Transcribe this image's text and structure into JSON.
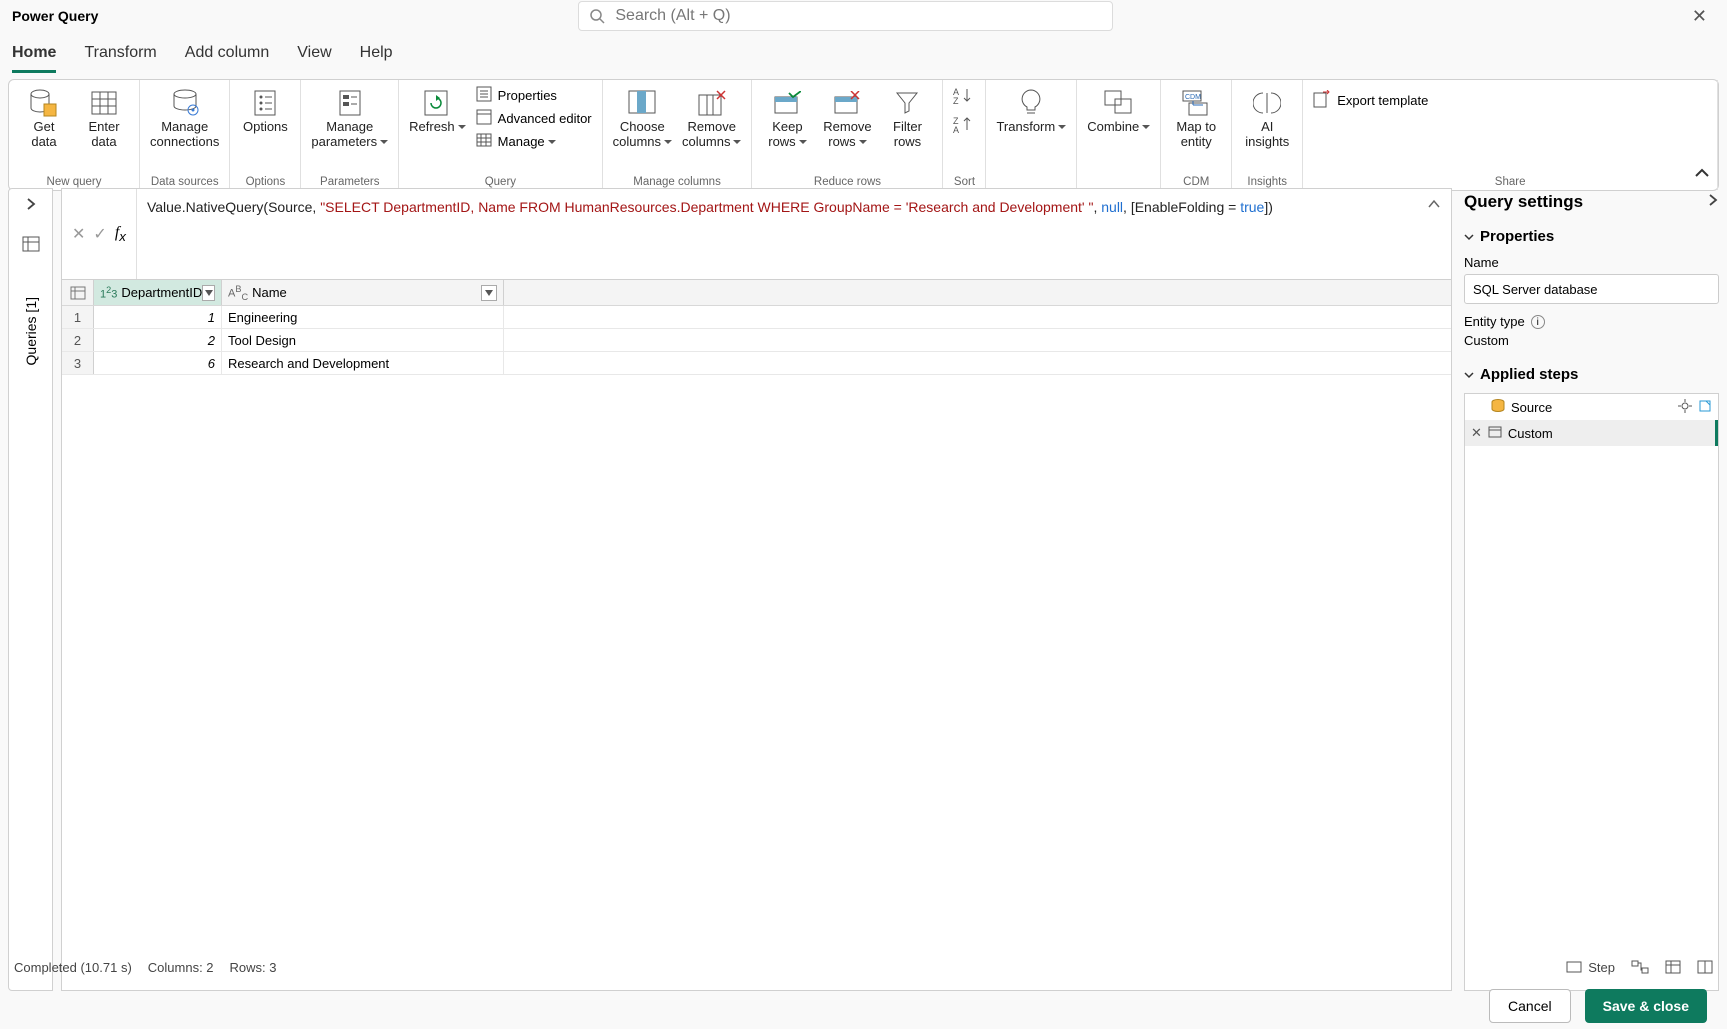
{
  "app_title": "Power Query",
  "search_placeholder": "Search (Alt + Q)",
  "tabs": {
    "home": "Home",
    "transform": "Transform",
    "add_column": "Add column",
    "view": "View",
    "help": "Help"
  },
  "ribbon": {
    "new_query": {
      "get_data": "Get\ndata",
      "enter_data": "Enter\ndata",
      "title": "New query"
    },
    "data_sources": {
      "manage_conn": "Manage\nconnections",
      "title": "Data sources"
    },
    "options": {
      "options": "Options",
      "title": "Options"
    },
    "parameters": {
      "manage_params": "Manage\nparameters",
      "title": "Parameters"
    },
    "query": {
      "refresh": "Refresh",
      "properties": "Properties",
      "advanced": "Advanced editor",
      "manage": "Manage",
      "title": "Query"
    },
    "manage_columns": {
      "choose": "Choose\ncolumns",
      "remove": "Remove\ncolumns",
      "title": "Manage columns"
    },
    "reduce_rows": {
      "keep": "Keep\nrows",
      "remove": "Remove\nrows",
      "filter": "Filter\nrows",
      "title": "Reduce rows"
    },
    "sort": {
      "title": "Sort"
    },
    "transform": {
      "label": "Transform"
    },
    "combine": {
      "label": "Combine"
    },
    "cdm": {
      "map": "Map to\nentity",
      "title": "CDM"
    },
    "insights": {
      "ai": "AI\ninsights",
      "title": "Insights"
    },
    "share": {
      "export": "Export template",
      "title": "Share"
    }
  },
  "queries_panel_label": "Queries [1]",
  "formula": {
    "p1": "Value.NativeQuery(Source, ",
    "str": "\"SELECT DepartmentID, Name FROM HumanResources.Department WHERE GroupName = 'Research and Development'  \"",
    "p2": ", ",
    "null": "null",
    "p3": ", [EnableFolding = ",
    "true": "true",
    "p4": "])"
  },
  "grid": {
    "col1_header": "DepartmentID",
    "col2_header": "Name",
    "rows": [
      {
        "n": "1",
        "id": "1",
        "name": "Engineering"
      },
      {
        "n": "2",
        "id": "2",
        "name": "Tool Design"
      },
      {
        "n": "3",
        "id": "6",
        "name": "Research and Development"
      }
    ]
  },
  "settings": {
    "title": "Query settings",
    "properties": "Properties",
    "name_label": "Name",
    "name_value": "SQL Server database",
    "entity_type_label": "Entity type",
    "entity_type_value": "Custom",
    "applied_steps": "Applied steps",
    "steps": {
      "source": "Source",
      "custom": "Custom"
    }
  },
  "status": {
    "completed": "Completed (10.71 s)",
    "columns": "Columns: 2",
    "rows": "Rows: 3",
    "step": "Step"
  },
  "footer": {
    "cancel": "Cancel",
    "save": "Save & close"
  }
}
